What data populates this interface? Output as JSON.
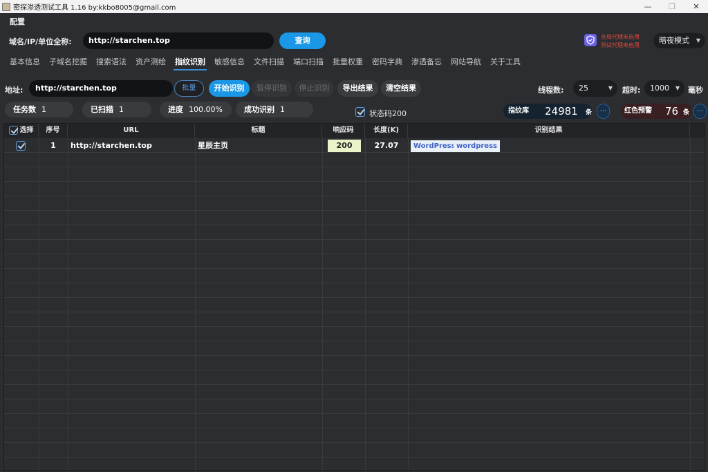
{
  "window": {
    "title": "密探渗透测试工具 1.16 by:kkbo8005@gmail.com"
  },
  "menu": {
    "config": "配置"
  },
  "search": {
    "label": "域名/IP/单位全称:",
    "value": "http://starchen.top",
    "button": "查询"
  },
  "proxy": {
    "global": "全局代理未启用",
    "test": "测试代理未启用"
  },
  "mode": {
    "value": "暗夜模式"
  },
  "tabs": [
    "基本信息",
    "子域名挖掘",
    "搜索语法",
    "资产测绘",
    "指纹识别",
    "敏感信息",
    "文件扫描",
    "端口扫描",
    "批量权重",
    "密码字典",
    "渗透备忘",
    "网站导航",
    "关于工具"
  ],
  "active_tab": "指纹识别",
  "toolbar": {
    "addr_label": "地址:",
    "addr_value": "http://starchen.top",
    "batch": "批量",
    "start": "开始识别",
    "pause": "暂停识别",
    "stop": "停止识别",
    "export": "导出结果",
    "clear": "清空结果",
    "threads_label": "线程数:",
    "threads_value": "25",
    "timeout_label": "超时:",
    "timeout_value": "1000",
    "ms_label": "毫秒"
  },
  "stats": {
    "tasks_label": "任务数",
    "tasks_value": "1",
    "scanned_label": "已扫描",
    "scanned_value": "1",
    "progress_label": "进度",
    "progress_value": "100.00%",
    "success_label": "成功识别",
    "success_value": "1",
    "status200_label": "状态码200",
    "fp_label": "指纹库",
    "fp_value": "24981",
    "fp_unit": "条",
    "red_label": "红色预警",
    "red_value": "76",
    "red_unit": "条",
    "more": "..."
  },
  "table": {
    "headers": {
      "select": "选择",
      "index": "序号",
      "url": "URL",
      "title": "标题",
      "code": "响应码",
      "length": "长度(K)",
      "result": "识别结果"
    },
    "rows": [
      {
        "index": "1",
        "url": "http://starchen.top",
        "title": "星辰主页",
        "code": "200",
        "length": "27.07",
        "tags": [
          "WordPress",
          "wordpress"
        ]
      }
    ]
  },
  "colors": {
    "accent": "#1a97e6",
    "bg": "#2b2d30",
    "alert": "#e04a3e"
  }
}
